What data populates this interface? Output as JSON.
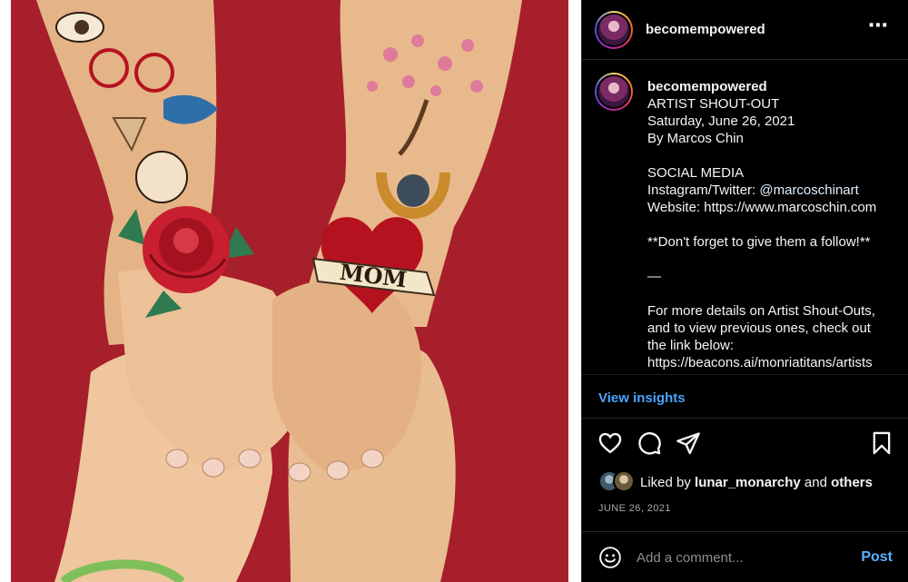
{
  "post": {
    "username": "becomempowered",
    "more_icon": "more-horizontal-icon"
  },
  "caption": {
    "username": "becomempowered",
    "lines": [
      "ARTIST SHOUT-OUT",
      "Saturday, June 26, 2021",
      "By Marcos Chin",
      "",
      "SOCIAL MEDIA",
      "Instagram/Twitter: ",
      "Website: https://www.marcoschin.com",
      "",
      "**Don't forget to give them a follow!**",
      "",
      "—",
      "",
      "For more details on Artist Shout-Outs,",
      "and to view previous ones, check out",
      "the link below:",
      "https://beacons.ai/monriatitans/artists"
    ],
    "mention": "@marcoschinart"
  },
  "insights": {
    "label": "View insights"
  },
  "actions": {
    "like_icon": "heart-icon",
    "comment_icon": "comment-icon",
    "share_icon": "send-icon",
    "save_icon": "bookmark-icon"
  },
  "likes": {
    "prefix": "Liked by ",
    "user": "lunar_monarchy",
    "middle": " and ",
    "others": "others"
  },
  "date": "JUNE 26, 2021",
  "comment": {
    "placeholder": "Add a comment...",
    "post_label": "Post",
    "emoji_icon": "emoji-icon"
  },
  "image": {
    "banner_text": "MOM",
    "background_color": "#a61f2b"
  },
  "colors": {
    "link": "#4aa3ff",
    "post_button": "#5ab0ff",
    "muted": "#a8a8a8"
  }
}
